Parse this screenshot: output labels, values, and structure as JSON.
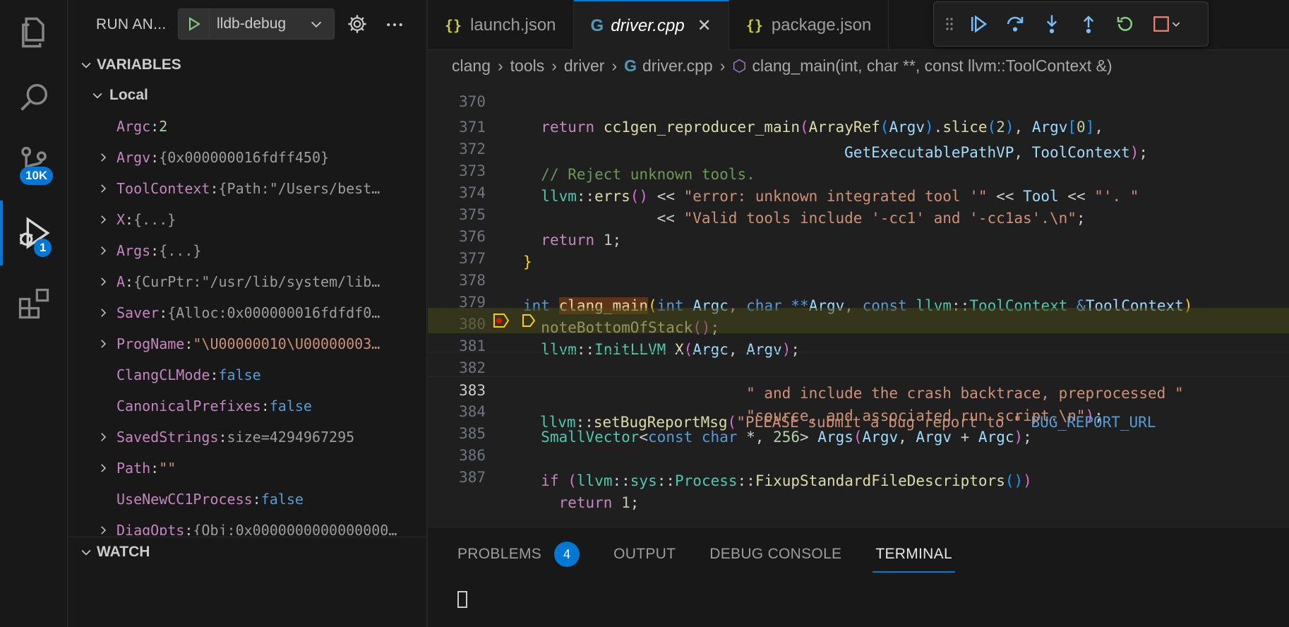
{
  "activity_bar": {
    "scm_badge": "10K",
    "debug_badge": "1"
  },
  "sidebar": {
    "run_label": "RUN AN...",
    "config_name": "lldb-debug",
    "variables_title": "VARIABLES",
    "local_title": "Local",
    "watch_title": "WATCH",
    "variables": [
      {
        "name": "Argc",
        "value": "2",
        "kind": "num",
        "expandable": false
      },
      {
        "name": "Argv",
        "value": "{0x000000016fdff450}",
        "kind": "plain",
        "expandable": true
      },
      {
        "name": "ToolContext",
        "value": "{Path:\"/Users/best…",
        "kind": "plain",
        "expandable": true
      },
      {
        "name": "X",
        "value": "{...}",
        "kind": "plain",
        "expandable": true
      },
      {
        "name": "Args",
        "value": "{...}",
        "kind": "plain",
        "expandable": true
      },
      {
        "name": "A",
        "value": "{CurPtr:\"/usr/lib/system/lib…",
        "kind": "plain",
        "expandable": true
      },
      {
        "name": "Saver",
        "value": "{Alloc:0x000000016fdfdf0…",
        "kind": "plain",
        "expandable": true
      },
      {
        "name": "ProgName",
        "value": "\"\\U00000010\\U00000003…",
        "kind": "str",
        "expandable": true
      },
      {
        "name": "ClangCLMode",
        "value": "false",
        "kind": "bool",
        "expandable": false
      },
      {
        "name": "CanonicalPrefixes",
        "value": "false",
        "kind": "bool",
        "expandable": false
      },
      {
        "name": "SavedStrings",
        "value": "size=4294967295",
        "kind": "plain",
        "expandable": true
      },
      {
        "name": "Path",
        "value": "\"\"",
        "kind": "str",
        "expandable": true
      },
      {
        "name": "UseNewCC1Process",
        "value": "false",
        "kind": "bool",
        "expandable": false
      },
      {
        "name": "DiagOpts",
        "value": "{Obj:0x0000000000000000…",
        "kind": "plain",
        "expandable": true
      }
    ]
  },
  "tabs": [
    {
      "label": "launch.json",
      "icon": "{}",
      "active": false
    },
    {
      "label": "driver.cpp",
      "icon": "G",
      "active": true
    },
    {
      "label": "package.json",
      "icon": "{}",
      "active": false
    }
  ],
  "breadcrumb": [
    "clang",
    "tools",
    "driver",
    "driver.cpp",
    "clang_main(int, char **, const llvm::ToolContext &)"
  ],
  "code_lines": {
    "l370": "370",
    "l371": "371",
    "l372": "372",
    "l373": "373",
    "l374": "374",
    "l375": "375",
    "l376": "376",
    "l377": "377",
    "l378": "378",
    "l379": "379",
    "l380": "380",
    "l381": "381",
    "l382": "382",
    "l383": "383",
    "l384": "384",
    "l385": "385",
    "l386": "386",
    "l387": "387"
  },
  "panel": {
    "tabs": [
      "PROBLEMS",
      "OUTPUT",
      "DEBUG CONSOLE",
      "TERMINAL"
    ],
    "problems_count": "4",
    "active_tab": "TERMINAL"
  },
  "colors": {
    "accent": "#0078d4",
    "editor_bg": "#1f1f1f",
    "sidebar_bg": "#181818",
    "current_line_hl": "#4b4b18"
  }
}
